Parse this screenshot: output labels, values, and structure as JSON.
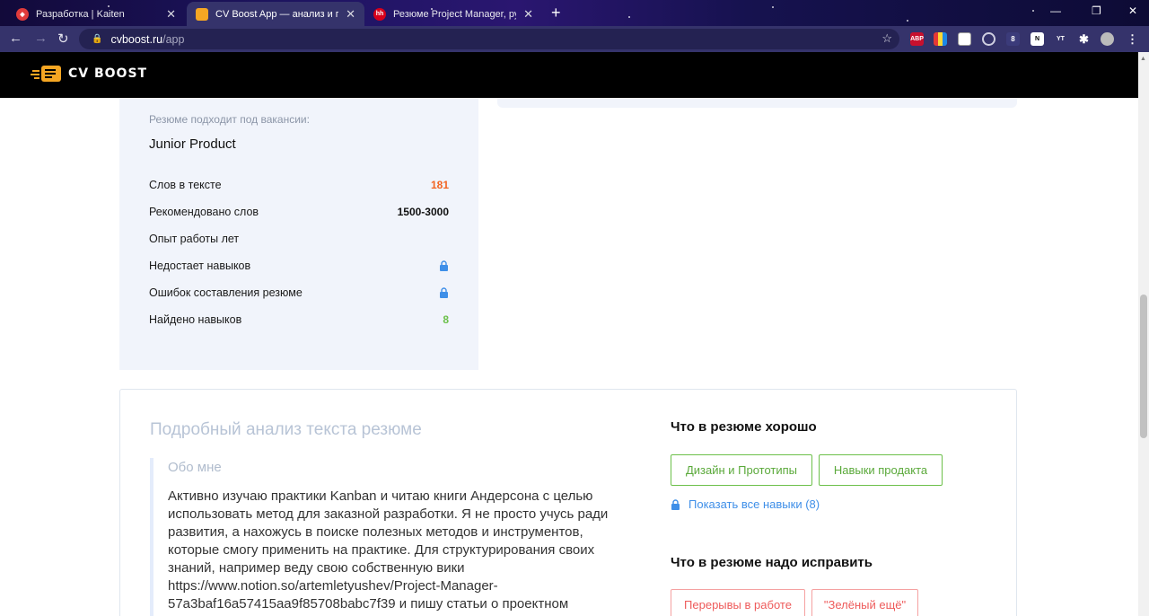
{
  "browser": {
    "tabs": [
      {
        "title": "Разработка | Kaiten",
        "favicon": "kaiten-icon"
      },
      {
        "title": "CV Boost App — анализ и повы",
        "favicon": "cvboost-icon"
      },
      {
        "title": "Резюме Project Manager, руков",
        "favicon": "hh-icon",
        "favicon_text": "hh"
      }
    ],
    "url_host": "cvboost.ru",
    "url_path": "/app",
    "extensions": [
      {
        "name": "adblock-icon",
        "text": "ABP"
      },
      {
        "name": "yt-extension-icon",
        "text": "YT"
      },
      {
        "name": "notion-icon",
        "text": "N"
      }
    ],
    "badge_count": "8"
  },
  "site": {
    "logo_text": "CV BOOST"
  },
  "summary": {
    "fits_label": "Резюме подходит под вакансии:",
    "fits_value": "Junior Product",
    "stats": [
      {
        "label": "Слов в тексте",
        "value": "181",
        "color": "#f26522"
      },
      {
        "label": "Рекомендовано слов",
        "value": "1500-3000",
        "color": "#111111"
      },
      {
        "label": "Опыт работы лет",
        "value": ""
      },
      {
        "label": "Недостает навыков",
        "value": "",
        "locked": true
      },
      {
        "label": "Ошибок составления резюме",
        "value": "",
        "locked": true
      },
      {
        "label": "Найдено навыков",
        "value": "8",
        "color": "#6cc04a"
      }
    ]
  },
  "analysis": {
    "title": "Подробный анализ текста резюме",
    "about_label": "Обо мне",
    "about_lines": [
      "Активно изучаю практики Kanban и читаю книги Андерсона с целью",
      "использовать метод для заказной разработки. Я не просто учусь ради",
      "развития, а нахожусь в поиске полезных методов и инструментов,",
      "которые смогу применить на практике. Для структурирования своих",
      "знаний, например веду свою собственную вики",
      "https://www.notion.so/artemletyushev/Project-Manager-",
      "57a3baf16a57415aa9f85708babc7f39 и пишу статьи о проектном"
    ],
    "good_title": "Что в резюме хорошо",
    "good_skills": [
      "Дизайн и Прототипы",
      "Навыки продакта"
    ],
    "show_all": "Показать все навыки (8)",
    "fix_title": "Что в резюме надо исправить",
    "fix_items": [
      "Перерывы в работе",
      "\"Зелёный ещё\""
    ]
  }
}
